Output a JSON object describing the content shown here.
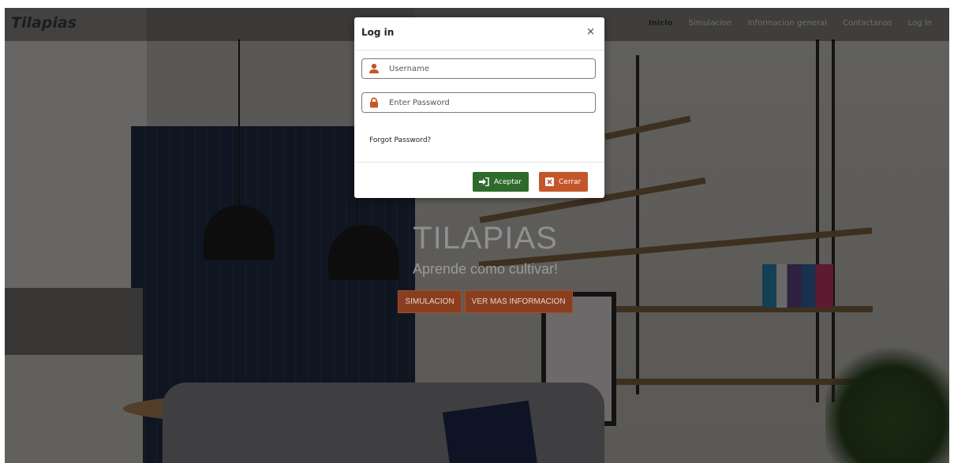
{
  "navbar": {
    "brand": "Tilapias",
    "links": [
      "Inicio",
      "Simulacion",
      "Informacion general",
      "Contactanos",
      "Log In"
    ]
  },
  "hero": {
    "title": "TILAPIAS",
    "subtitle": "Aprende como cultivar!",
    "buttons": [
      "SIMULACION",
      "VER MAS INFORMACION"
    ]
  },
  "modal": {
    "title": "Log in",
    "close_glyph": "×",
    "username_placeholder": "Username",
    "password_placeholder": "Enter Password",
    "forgot": "Forgot Password?",
    "accept_label": "Aceptar",
    "cancel_label": "Cerrar"
  },
  "colors": {
    "accept": "#2f6a2d",
    "cancel": "#c4572a",
    "hero_button": "#8a3e20",
    "icon": "#c4572a"
  },
  "icons": [
    "user-icon",
    "lock-icon",
    "sign-in-icon",
    "close-box-icon"
  ]
}
